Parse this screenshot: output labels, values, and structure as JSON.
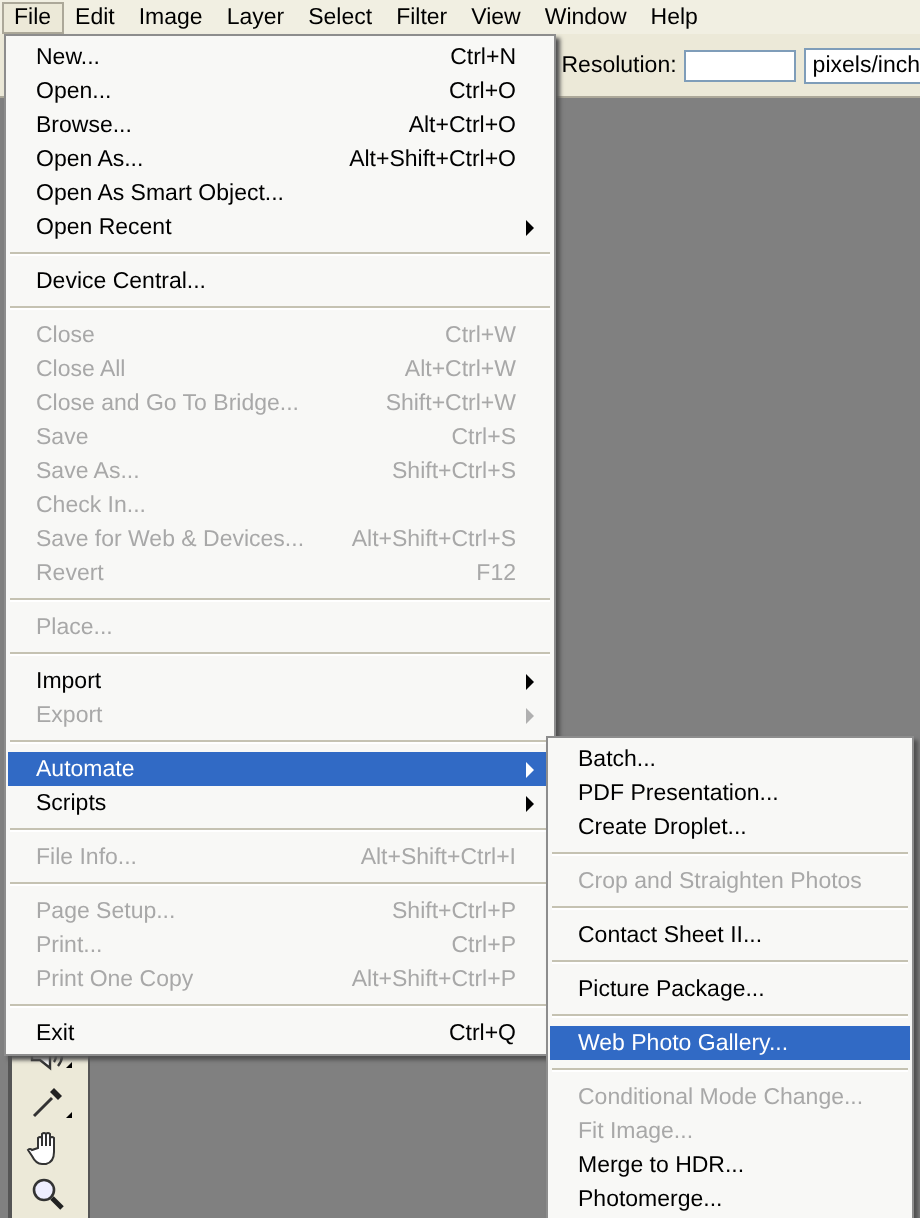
{
  "menubar": [
    {
      "label": "File",
      "selected": true
    },
    {
      "label": "Edit",
      "selected": false
    },
    {
      "label": "Image",
      "selected": false
    },
    {
      "label": "Layer",
      "selected": false
    },
    {
      "label": "Select",
      "selected": false
    },
    {
      "label": "Filter",
      "selected": false
    },
    {
      "label": "View",
      "selected": false
    },
    {
      "label": "Window",
      "selected": false
    },
    {
      "label": "Help",
      "selected": false
    }
  ],
  "options_bar": {
    "resolution_label": "Resolution:",
    "resolution_unit": "pixels/inch"
  },
  "file_menu": [
    {
      "kind": "item",
      "label": "New...",
      "shortcut": "Ctrl+N",
      "disabled": false,
      "submenu": false,
      "selected": false
    },
    {
      "kind": "item",
      "label": "Open...",
      "shortcut": "Ctrl+O",
      "disabled": false,
      "submenu": false,
      "selected": false
    },
    {
      "kind": "item",
      "label": "Browse...",
      "shortcut": "Alt+Ctrl+O",
      "disabled": false,
      "submenu": false,
      "selected": false
    },
    {
      "kind": "item",
      "label": "Open As...",
      "shortcut": "Alt+Shift+Ctrl+O",
      "disabled": false,
      "submenu": false,
      "selected": false
    },
    {
      "kind": "item",
      "label": "Open As Smart Object...",
      "disabled": false,
      "submenu": false,
      "selected": false
    },
    {
      "kind": "item",
      "label": "Open Recent",
      "disabled": false,
      "submenu": true,
      "selected": false
    },
    {
      "kind": "separator"
    },
    {
      "kind": "item",
      "label": "Device Central...",
      "disabled": false,
      "submenu": false,
      "selected": false
    },
    {
      "kind": "separator"
    },
    {
      "kind": "item",
      "label": "Close",
      "shortcut": "Ctrl+W",
      "disabled": true,
      "submenu": false,
      "selected": false
    },
    {
      "kind": "item",
      "label": "Close All",
      "shortcut": "Alt+Ctrl+W",
      "disabled": true,
      "submenu": false,
      "selected": false
    },
    {
      "kind": "item",
      "label": "Close and Go To Bridge...",
      "shortcut": "Shift+Ctrl+W",
      "disabled": true,
      "submenu": false,
      "selected": false
    },
    {
      "kind": "item",
      "label": "Save",
      "shortcut": "Ctrl+S",
      "disabled": true,
      "submenu": false,
      "selected": false
    },
    {
      "kind": "item",
      "label": "Save As...",
      "shortcut": "Shift+Ctrl+S",
      "disabled": true,
      "submenu": false,
      "selected": false
    },
    {
      "kind": "item",
      "label": "Check In...",
      "disabled": true,
      "submenu": false,
      "selected": false
    },
    {
      "kind": "item",
      "label": "Save for Web & Devices...",
      "shortcut": "Alt+Shift+Ctrl+S",
      "disabled": true,
      "submenu": false,
      "selected": false
    },
    {
      "kind": "item",
      "label": "Revert",
      "shortcut": "F12",
      "disabled": true,
      "submenu": false,
      "selected": false
    },
    {
      "kind": "separator"
    },
    {
      "kind": "item",
      "label": "Place...",
      "disabled": true,
      "submenu": false,
      "selected": false
    },
    {
      "kind": "separator"
    },
    {
      "kind": "item",
      "label": "Import",
      "disabled": false,
      "submenu": true,
      "selected": false
    },
    {
      "kind": "item",
      "label": "Export",
      "disabled": true,
      "submenu": true,
      "selected": false
    },
    {
      "kind": "separator"
    },
    {
      "kind": "item",
      "label": "Automate",
      "disabled": false,
      "submenu": true,
      "selected": true
    },
    {
      "kind": "item",
      "label": "Scripts",
      "disabled": false,
      "submenu": true,
      "selected": false
    },
    {
      "kind": "separator"
    },
    {
      "kind": "item",
      "label": "File Info...",
      "shortcut": "Alt+Shift+Ctrl+I",
      "disabled": true,
      "submenu": false,
      "selected": false
    },
    {
      "kind": "separator"
    },
    {
      "kind": "item",
      "label": "Page Setup...",
      "shortcut": "Shift+Ctrl+P",
      "disabled": true,
      "submenu": false,
      "selected": false
    },
    {
      "kind": "item",
      "label": "Print...",
      "shortcut": "Ctrl+P",
      "disabled": true,
      "submenu": false,
      "selected": false
    },
    {
      "kind": "item",
      "label": "Print One Copy",
      "shortcut": "Alt+Shift+Ctrl+P",
      "disabled": true,
      "submenu": false,
      "selected": false
    },
    {
      "kind": "separator"
    },
    {
      "kind": "item",
      "label": "Exit",
      "shortcut": "Ctrl+Q",
      "disabled": false,
      "submenu": false,
      "selected": false
    }
  ],
  "automate_menu": [
    {
      "kind": "item",
      "label": "Batch...",
      "disabled": false,
      "selected": false
    },
    {
      "kind": "item",
      "label": "PDF Presentation...",
      "disabled": false,
      "selected": false
    },
    {
      "kind": "item",
      "label": "Create Droplet...",
      "disabled": false,
      "selected": false
    },
    {
      "kind": "separator"
    },
    {
      "kind": "item",
      "label": "Crop and Straighten Photos",
      "disabled": true,
      "selected": false
    },
    {
      "kind": "separator"
    },
    {
      "kind": "item",
      "label": "Contact Sheet II...",
      "disabled": false,
      "selected": false
    },
    {
      "kind": "separator"
    },
    {
      "kind": "item",
      "label": "Picture Package...",
      "disabled": false,
      "selected": false
    },
    {
      "kind": "separator"
    },
    {
      "kind": "item",
      "label": "Web Photo Gallery...",
      "disabled": false,
      "selected": true
    },
    {
      "kind": "separator"
    },
    {
      "kind": "item",
      "label": "Conditional Mode Change...",
      "disabled": true,
      "selected": false
    },
    {
      "kind": "item",
      "label": "Fit Image...",
      "disabled": true,
      "selected": false
    },
    {
      "kind": "item",
      "label": "Merge to HDR...",
      "disabled": false,
      "selected": false
    },
    {
      "kind": "item",
      "label": "Photomerge...",
      "disabled": false,
      "selected": false
    }
  ]
}
